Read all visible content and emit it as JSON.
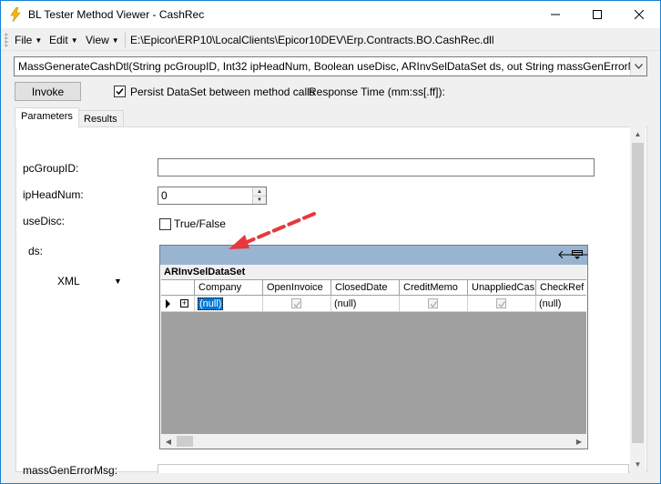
{
  "window": {
    "title": "BL Tester Method Viewer - CashRec",
    "controls": [
      "minimize",
      "maximize",
      "close"
    ]
  },
  "menu": {
    "items": [
      {
        "label": "File"
      },
      {
        "label": "Edit"
      },
      {
        "label": "View"
      }
    ],
    "assembly_path": "E:\\Epicor\\ERP10\\LocalClients\\Epicor10DEV\\Erp.Contracts.BO.CashRec.dll"
  },
  "method": {
    "signature": "MassGenerateCashDtl(String pcGroupID, Int32 ipHeadNum, Boolean useDisc, ARInvSelDataSet ds, out String massGenErrorMsg, out"
  },
  "toolbar": {
    "invoke_label": "Invoke",
    "persist_label": "Persist DataSet between method calls",
    "persist_checked": true,
    "response_time_label": "Response Time (mm:ss[.ff]):"
  },
  "tabs": [
    {
      "label": "Parameters",
      "active": true
    },
    {
      "label": "Results",
      "active": false
    }
  ],
  "params": {
    "pcGroupID": {
      "label": "pcGroupID:",
      "value": ""
    },
    "ipHeadNum": {
      "label": "ipHeadNum:",
      "value": "0"
    },
    "useDisc": {
      "label": "useDisc:",
      "checkbox_label": "True/False",
      "checked": false
    },
    "ds": {
      "label": "ds:",
      "format": "XML"
    },
    "massGenErrorMsg": {
      "label": "massGenErrorMsg:"
    }
  },
  "grid": {
    "table_name": "ARInvSelDataSet",
    "columns": [
      "Company",
      "OpenInvoice",
      "ClosedDate",
      "CreditMemo",
      "UnappliedCas",
      "CheckRef"
    ],
    "row": {
      "Company": "(null)",
      "OpenInvoice": true,
      "ClosedDate": "(null)",
      "CreditMemo": true,
      "UnappliedCas": true,
      "CheckRef": "(null)"
    },
    "expand_symbol": "+"
  },
  "colors": {
    "grid_caption": "#99b4d1",
    "selection": "#0078d7",
    "annotation_arrow": "#e5393d"
  }
}
